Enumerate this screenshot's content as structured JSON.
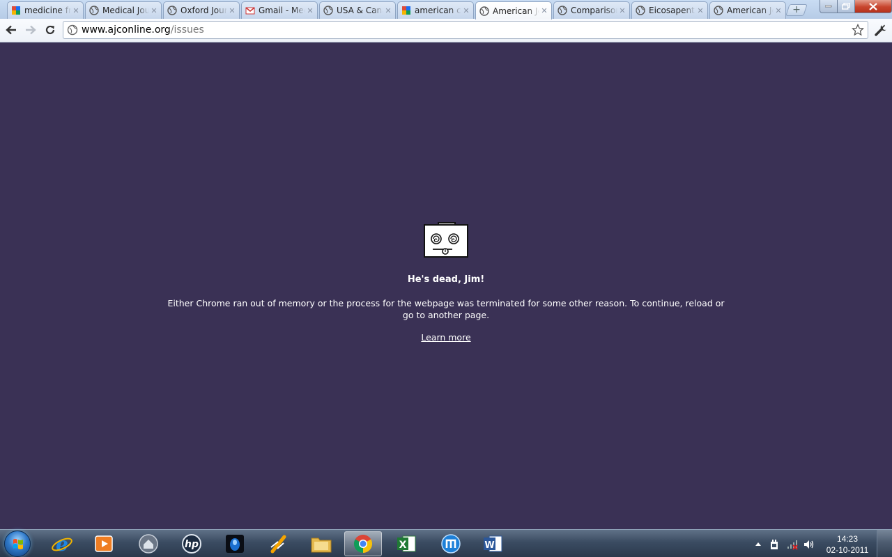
{
  "tabs": [
    {
      "title": "medicine fr",
      "icon": "google-icon",
      "active": false
    },
    {
      "title": "Medical Jou",
      "icon": "globe-icon",
      "active": false
    },
    {
      "title": "Oxford Jour",
      "icon": "globe-icon",
      "active": false
    },
    {
      "title": "Gmail - Mec",
      "icon": "gmail-icon",
      "active": false
    },
    {
      "title": "USA & Cana",
      "icon": "globe-icon",
      "active": false
    },
    {
      "title": "american ca",
      "icon": "google-icon",
      "active": false
    },
    {
      "title": "American Jc",
      "icon": "globe-icon",
      "active": true
    },
    {
      "title": "Comparisor",
      "icon": "globe-icon",
      "active": false
    },
    {
      "title": "Eicosapenta",
      "icon": "globe-icon",
      "active": false
    },
    {
      "title": "American Jc",
      "icon": "globe-icon",
      "active": false
    }
  ],
  "omnibox": {
    "host": "www.ajconline.org",
    "path": "/issues"
  },
  "sad_tab": {
    "title": "He's dead, Jim!",
    "message": "Either Chrome ran out of memory or the process for the webpage was terminated for some other reason.  To continue, reload or go to another page.",
    "link": "Learn more",
    "background_color": "#3a3155"
  },
  "taskbar": {
    "apps": [
      "internet-explorer-icon",
      "media-player-icon",
      "home-network-icon",
      "hp-icon",
      "dark-orb-app-icon",
      "winamp-icon",
      "file-explorer-icon",
      "chrome-icon",
      "excel-icon",
      "maxthon-icon",
      "word-icon"
    ],
    "active_app": "chrome-icon"
  },
  "clock": {
    "time": "14:23",
    "date": "02-10-2011"
  }
}
